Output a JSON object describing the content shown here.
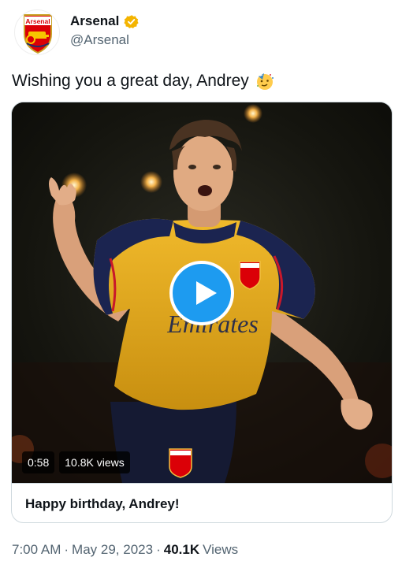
{
  "author": {
    "name": "Arsenal",
    "handle": "@Arsenal",
    "crest_text": "Arsenal",
    "verified_badge_color": "#f4b400",
    "icons": [
      "arsenal-crest-icon",
      "verified-badge-icon"
    ]
  },
  "tweet": {
    "text": "Wishing you a great day, Andrey",
    "emoji": "partying-face-icon"
  },
  "media": {
    "duration": "0:58",
    "views": "10.8K views",
    "card_title": "Happy birthday, Andrey!",
    "shirt_text": "Emirates",
    "play_button_color": "#1d9bf0"
  },
  "meta": {
    "time": "7:00 AM",
    "separator": "·",
    "date": "May 29, 2023",
    "views_count": "40.1K",
    "views_label": "Views"
  }
}
